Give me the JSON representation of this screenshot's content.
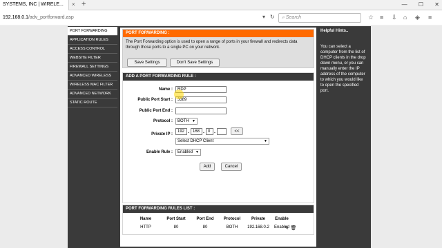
{
  "browser": {
    "tab_title": "SYSTEMS, INC | WIRELE...",
    "tab_close": "×",
    "tab_new": "+",
    "window_buttons": [
      "—",
      "☐",
      "✕"
    ],
    "url_host": "192.168.0.1",
    "url_path": "/adv_portforward.asp",
    "search_placeholder": "Search",
    "toolbar_icons": [
      "star-icon",
      "reading-list-icon",
      "download-icon",
      "home-icon",
      "pocket-icon",
      "menu-icon"
    ]
  },
  "sidebar": {
    "items": [
      {
        "label": "PORT FORWARDING"
      },
      {
        "label": "APPLICATION RULES"
      },
      {
        "label": "ACCESS CONTROL"
      },
      {
        "label": "WEBSITE FILTER"
      },
      {
        "label": "FIREWALL SETTINGS"
      },
      {
        "label": "ADVANCED WIRELESS"
      },
      {
        "label": "WIRELESS MAC FILTER"
      },
      {
        "label": "ADVANCED NETWORK"
      },
      {
        "label": "STATIC ROUTE"
      }
    ]
  },
  "intro": {
    "title": "PORT FORWARDING :",
    "text": "The Port Forwarding option is used to open a range of ports in your firewall and redirects data through those ports to a single PC on your network.",
    "save_label": "Save Settings",
    "dont_save_label": "Don't Save Settings"
  },
  "rule": {
    "title": "ADD A PORT FORWARDING RULE :",
    "name_label": "Name :",
    "name_value": "RDP",
    "public_start_label": "Public Port Start :",
    "public_start_value": "3389",
    "public_end_label": "Public Port End :",
    "public_end_value": "",
    "protocol_label": "Protocol :",
    "protocol_value": "BOTH",
    "private_ip_label": "Private IP :",
    "ip_octets": [
      "192",
      "168",
      "0",
      ""
    ],
    "copy_button": "<<",
    "dhcp_placeholder": "Select DHCP Client",
    "enable_label": "Enable Rule :",
    "enable_value": "Enabled",
    "add_label": "Add",
    "cancel_label": "Cancel"
  },
  "rules_list": {
    "title": "PORT FORWARDING RULES LIST :",
    "columns": [
      "Name",
      "Port Start",
      "Port End",
      "Protocol",
      "Private",
      "Enable"
    ],
    "rows": [
      {
        "name": "HTTP",
        "port_start": "80",
        "port_end": "80",
        "protocol": "BOTH",
        "private": "192.168.0.2",
        "enable": "Enabled"
      }
    ]
  },
  "hints": {
    "title": "Helpful Hints..",
    "body": "You can select a computer from the list of DHCP clients in the drop down menu, or you can manually enter the IP address of the computer to which you would like to open the specified port."
  },
  "colors": {
    "header_orange": "#ff6a00",
    "router_dark": "#3a3a3a"
  }
}
